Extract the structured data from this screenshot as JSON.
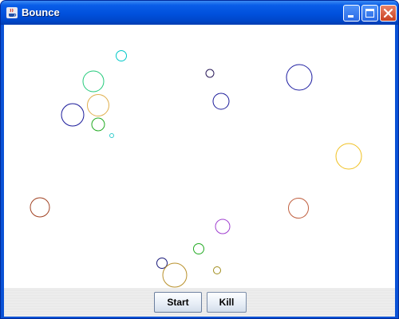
{
  "window": {
    "title": "Bounce"
  },
  "buttons": {
    "start_label": "Start",
    "kill_label": "Kill"
  },
  "balls": [
    {
      "color": "#00c8c8"
    },
    {
      "color": "#22c97a"
    },
    {
      "color": "#e0b050"
    },
    {
      "color": "#1a1a9a"
    },
    {
      "color": "#22aa22"
    },
    {
      "color": "#33cccc"
    },
    {
      "color": "#2a1a5a"
    },
    {
      "color": "#1a1aa0"
    },
    {
      "color": "#1a1a9a"
    },
    {
      "color": "#f0c020"
    },
    {
      "color": "#a04020"
    },
    {
      "color": "#c06040"
    },
    {
      "color": "#a040d0"
    },
    {
      "color": "#22aa22"
    },
    {
      "color": "#1a1a7a"
    },
    {
      "color": "#a08c1a"
    },
    {
      "color": "#b8902a"
    }
  ],
  "colors": {
    "titlebar": "#0050dc",
    "canvas_background": "#ffffff"
  }
}
